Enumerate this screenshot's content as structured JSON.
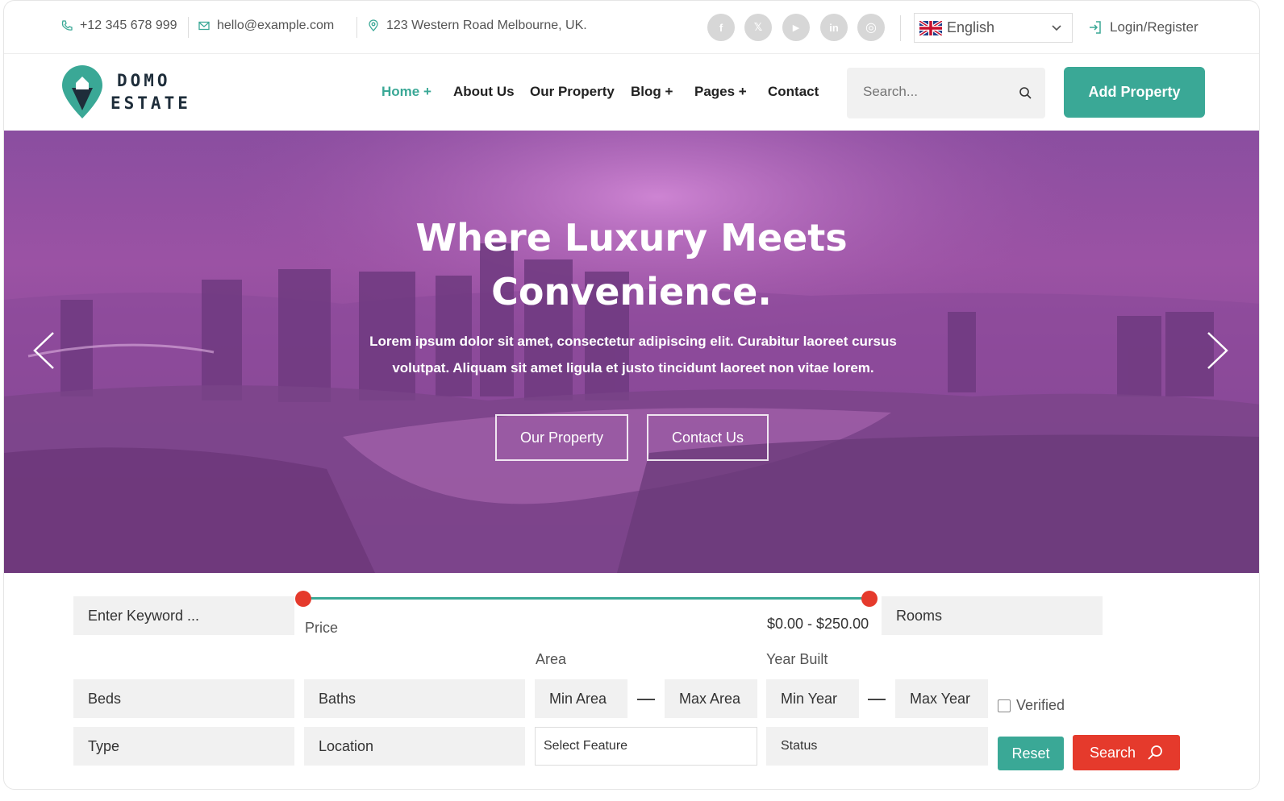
{
  "topbar": {
    "phone": "+12 345 678 999",
    "email": "hello@example.com",
    "address": "123 Western Road Melbourne, UK.",
    "socials": [
      {
        "name": "facebook",
        "glyph": "f"
      },
      {
        "name": "x",
        "glyph": "𝕏"
      },
      {
        "name": "youtube",
        "glyph": "▶"
      },
      {
        "name": "linkedin",
        "glyph": "in"
      },
      {
        "name": "instagram",
        "glyph": "◎"
      }
    ],
    "language": "English",
    "login": "Login/Register"
  },
  "brand": {
    "line1": "DOMO",
    "line2": "ESTATE",
    "accent": "#3aa896"
  },
  "nav": {
    "items": [
      "Home +",
      "About Us",
      "Our Property",
      "Blog +",
      "Pages +",
      "Contact"
    ],
    "search_placeholder": "Search...",
    "add_property": "Add Property"
  },
  "hero": {
    "title_line1": "Where Luxury Meets",
    "title_line2": "Convenience.",
    "subtitle_line1": "Lorem ipsum dolor sit amet, consectetur adipiscing elit. Curabitur laoreet cursus",
    "subtitle_line2": "volutpat. Aliquam sit amet ligula et justo tincidunt laoreet non vitae lorem.",
    "btn_property": "Our Property",
    "btn_contact": "Contact Us"
  },
  "search_form": {
    "keyword_placeholder": "Enter Keyword ...",
    "price_label": "Price",
    "price_range": "$0.00 - $250.00",
    "rooms": "Rooms",
    "area_label": "Area",
    "year_label": "Year Built",
    "beds": "Beds",
    "baths": "Baths",
    "min_area": "Min Area",
    "max_area": "Max Area",
    "min_year": "Min Year",
    "max_year": "Max Year",
    "verified": "Verified",
    "type": "Type",
    "location": "Location",
    "select_feature": "Select Feature",
    "status": "Status",
    "reset": "Reset",
    "search": "Search"
  }
}
